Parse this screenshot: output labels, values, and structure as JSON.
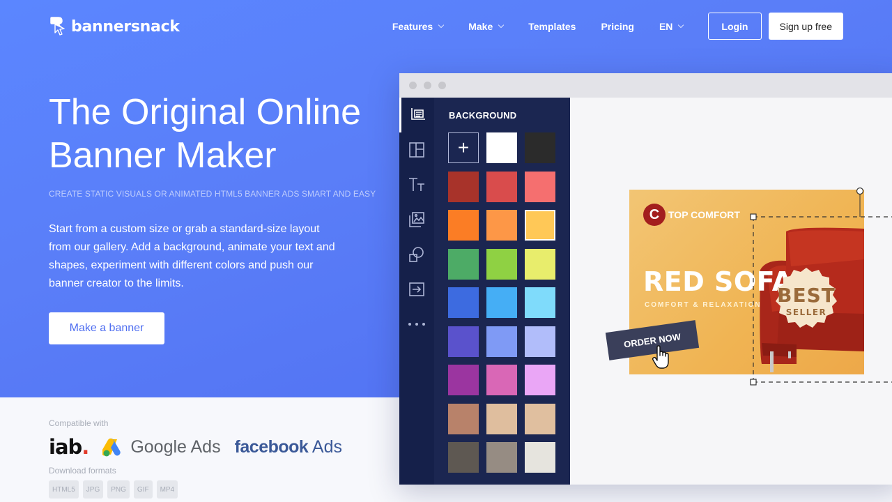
{
  "brand": {
    "name": "bannersnack"
  },
  "nav": {
    "items": [
      {
        "label": "Features",
        "dropdown": true
      },
      {
        "label": "Make",
        "dropdown": true
      },
      {
        "label": "Templates",
        "dropdown": false
      },
      {
        "label": "Pricing",
        "dropdown": false
      },
      {
        "label": "EN",
        "dropdown": true
      }
    ],
    "login": "Login",
    "signup": "Sign up free"
  },
  "hero": {
    "headline": "The Original Online Banner Maker",
    "subhead": "CREATE STATIC VISUALS OR ANIMATED HTML5 BANNER ADS SMART AND EASY",
    "description": "Start from a custom size or grab a standard-size layout from our gallery. Add a background, animate your text and shapes, experiment with different colors and push our banner creator to the limits.",
    "cta": "Make a banner"
  },
  "compat": {
    "label": "Compatible with",
    "iab": "iab",
    "iab_dot": ".",
    "google": "Google Ads",
    "facebook_bold": "facebook",
    "facebook_rest": " Ads"
  },
  "downloads": {
    "label": "Download formats",
    "formats": [
      "HTML5",
      "JPG",
      "PNG",
      "GIF",
      "MP4"
    ]
  },
  "editor": {
    "panel_title": "BACKGROUND",
    "tools": [
      "resize-icon",
      "layout-icon",
      "text-icon",
      "image-icon",
      "shapes-icon",
      "import-icon",
      "more-icon"
    ],
    "swatches": [
      "add",
      "#ffffff",
      "#2b2b2b",
      "#a8332a",
      "#d94c4c",
      "#f56f6f",
      "#fb7d25",
      "#fd9747",
      "#ffc857",
      "#4dab66",
      "#8fd143",
      "#e8ed6c",
      "#3d6be0",
      "#45aef5",
      "#7fdbfb",
      "#5a52cc",
      "#7f9af5",
      "#b1bdfa",
      "#9b35a0",
      "#d967b6",
      "#eaa6f6",
      "#b8826a",
      "#dfbe9e",
      "#e0bf9f",
      "#5e5852",
      "#968c83",
      "#e6e4de"
    ],
    "selected_swatch": 8
  },
  "banner": {
    "brand_letter": "C",
    "brand_name": "TOP COMFORT",
    "title": "RED SOFA",
    "tagline": "COMFORT & RELAXATION",
    "cta": "ORDER NOW",
    "badge_line1": "BEST",
    "badge_line2": "SELLER"
  }
}
